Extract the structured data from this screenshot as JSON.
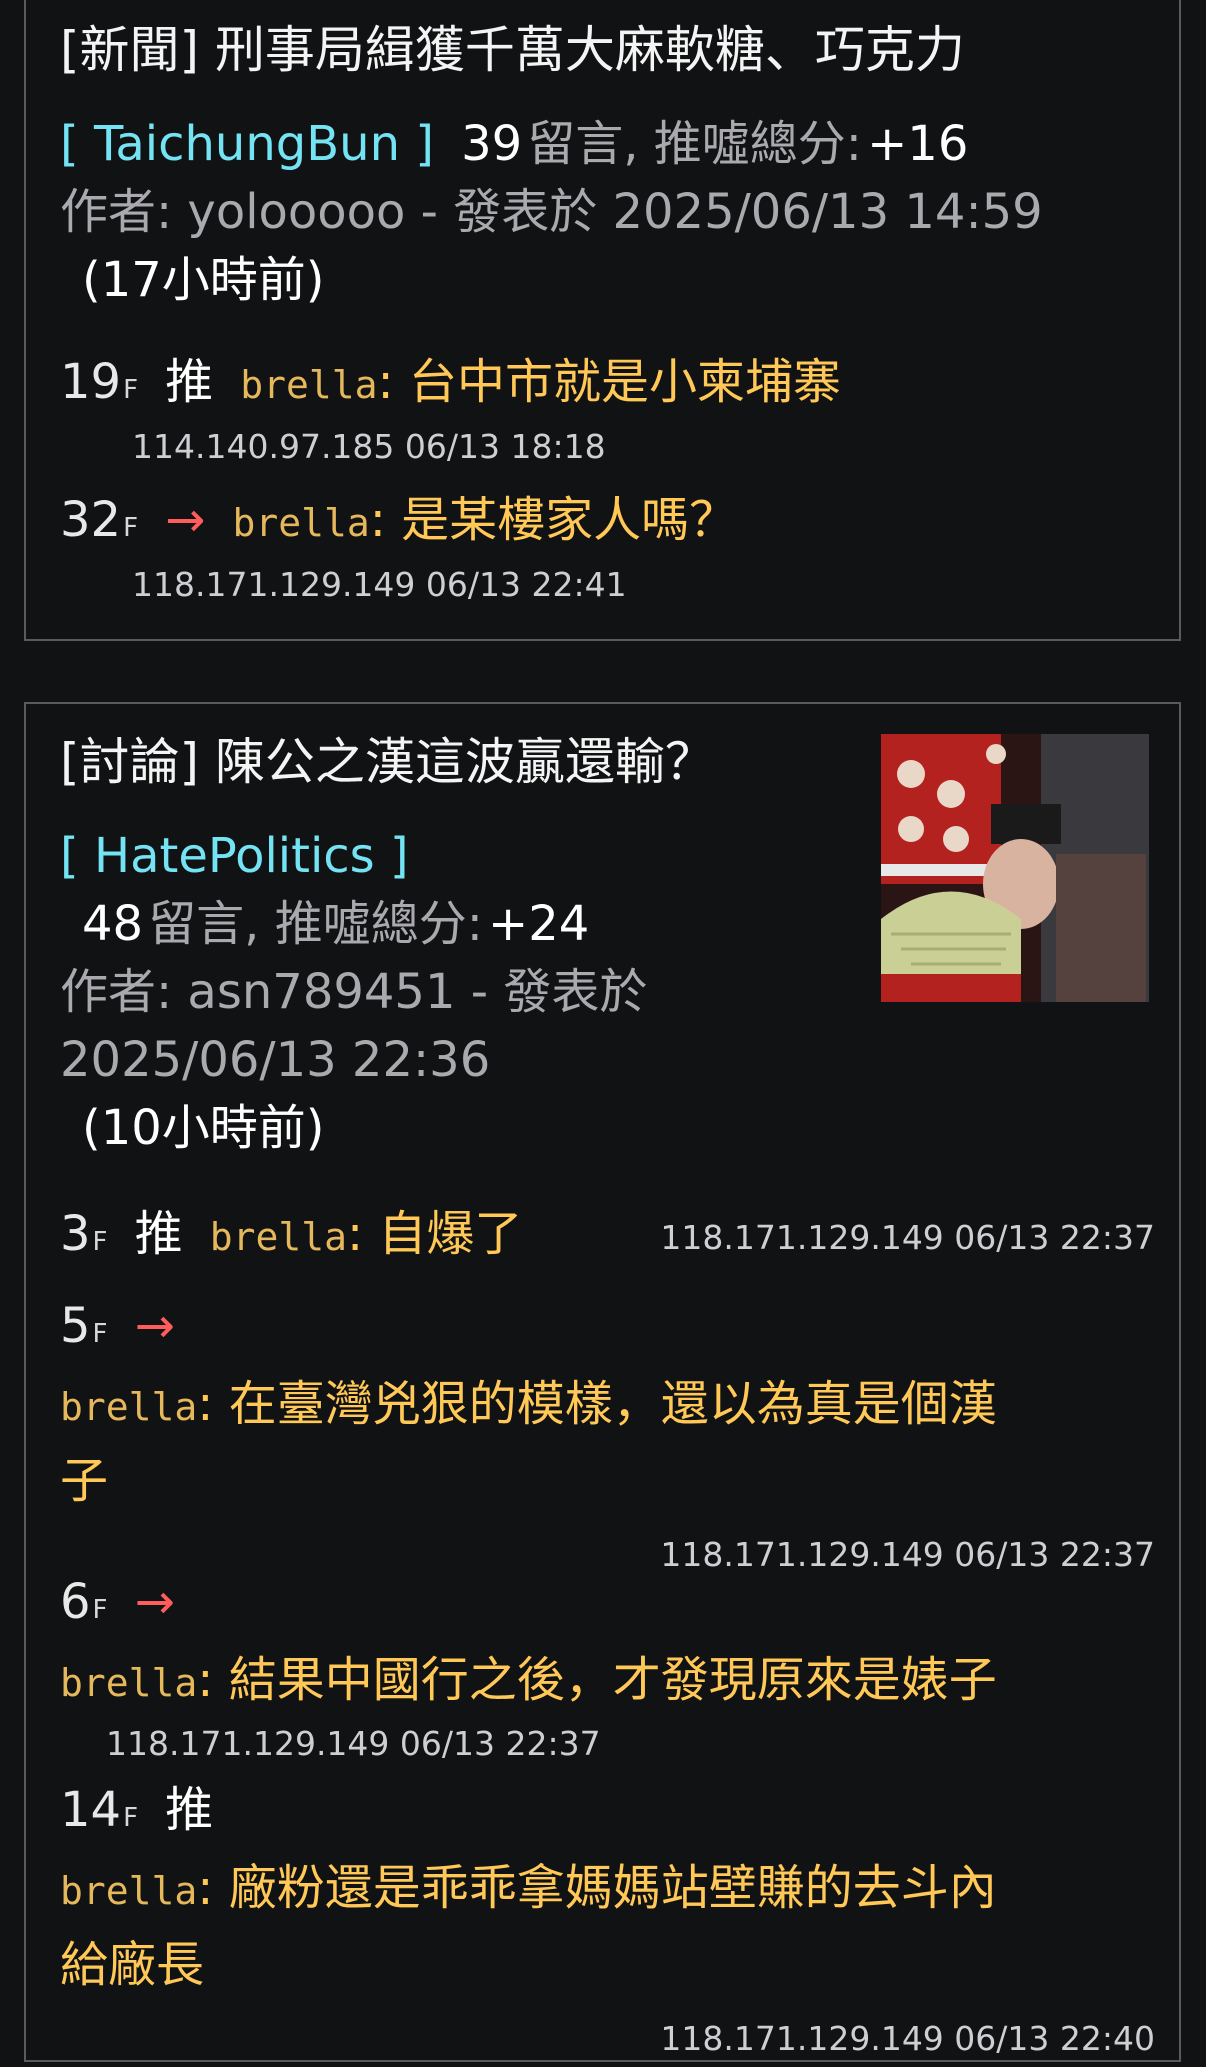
{
  "posts": [
    {
      "title": "[新聞] 刑事局緝獲千萬大麻軟糖、巧克力",
      "board": "[ TaichungBun ]",
      "comment_count": "39",
      "comment_label": "留言, 推噓總分:",
      "score": "+16",
      "author_line": "作者: yolooooo - 發表於 2025/06/13 14:59",
      "ago": "(17小時前)",
      "pushes": [
        {
          "floor": "19",
          "f": "F",
          "tag": "推",
          "user": "brella",
          "content": ": 台中市就是小柬埔寨",
          "ip": "114.140.97.185 06/13 18:18"
        },
        {
          "floor": "32",
          "f": "F",
          "tag": "→",
          "user": "brella",
          "content": ": 是某樓家人嗎？",
          "ip": "118.171.129.149 06/13 22:41"
        }
      ]
    },
    {
      "title": "[討論] 陳公之漢這波贏還輸？",
      "board": "[ HatePolitics ]",
      "comment_count": "48",
      "comment_label": "留言, 推噓總分:",
      "score": "+24",
      "author_line1": "作者: asn789451 - 發表於",
      "author_line2": "2025/06/13 22:36",
      "ago": "(10小時前)",
      "pushes": [
        {
          "floor": "3",
          "f": "F",
          "tag": "推",
          "user": "brella",
          "content": ": 自爆了",
          "ip": "118.171.129.149 06/13 22:37"
        },
        {
          "floor": "5",
          "f": "F",
          "tag": "→",
          "user": "brella",
          "content_line1": ": 在臺灣兇狠的模樣，還以為真是個漢",
          "content_line2": "子",
          "ip": "118.171.129.149 06/13 22:37"
        },
        {
          "floor": "6",
          "f": "F",
          "tag": "→",
          "user": "brella",
          "content": ": 結果中國行之後，才發現原來是婊子",
          "ip": "118.171.129.149 06/13 22:37"
        },
        {
          "floor": "14",
          "f": "F",
          "tag": "推",
          "user": "brella",
          "content_line1": ": 廠粉還是乖乖拿媽媽站壁賺的去斗內",
          "content_line2": "給廠長",
          "ip": "118.171.129.149 06/13 22:40"
        }
      ]
    }
  ],
  "colors": {
    "background": "#111213",
    "board": "#74e3f3",
    "user": "#e6b85c",
    "content": "#ffc857",
    "arrow": "#ff5c5c",
    "meta_grey": "#a9a9ae"
  }
}
